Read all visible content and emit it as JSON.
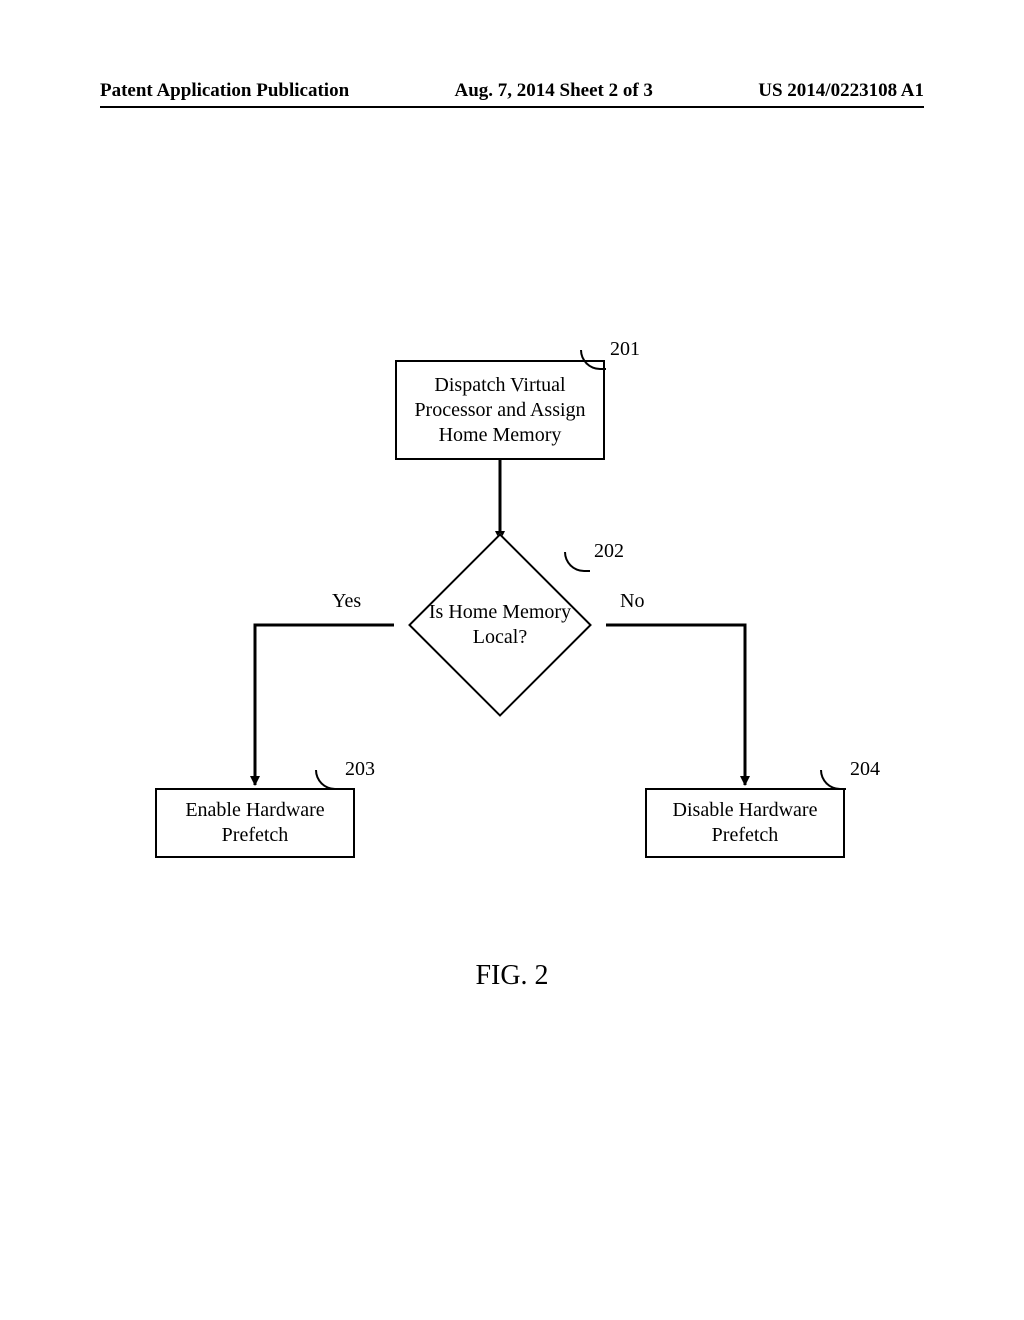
{
  "header": {
    "left": "Patent Application Publication",
    "center": "Aug. 7, 2014   Sheet 2 of 3",
    "right": "US 2014/0223108 A1"
  },
  "figure_caption": "FIG. 2",
  "nodes": {
    "n201": {
      "ref": "201",
      "text": "Dispatch Virtual Processor and Assign Home Memory"
    },
    "n202": {
      "ref": "202",
      "text": "Is Home Memory Local?"
    },
    "n203": {
      "ref": "203",
      "text": "Enable Hardware Prefetch"
    },
    "n204": {
      "ref": "204",
      "text": "Disable Hardware Prefetch"
    }
  },
  "edges": {
    "yes": "Yes",
    "no": "No"
  }
}
